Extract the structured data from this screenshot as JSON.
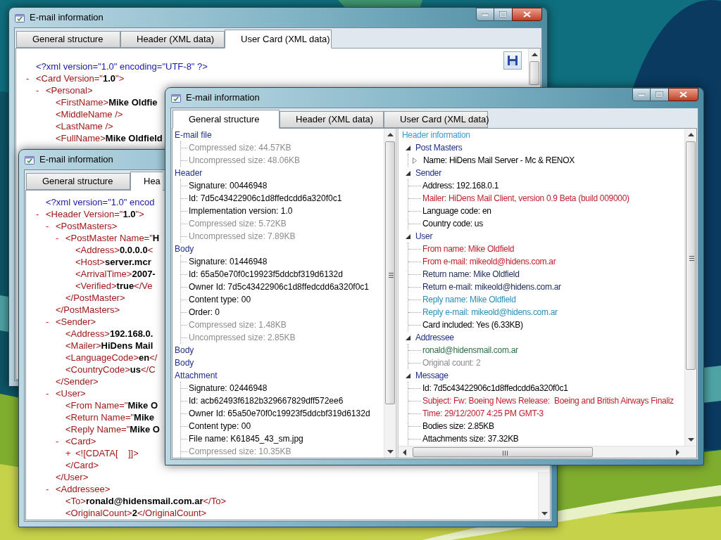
{
  "windows": [
    {
      "title": "E-mail information",
      "caption_buttons": true,
      "save_button": true,
      "tabs": [
        {
          "label": "General structure",
          "selected": false
        },
        {
          "label": "Header (XML data)",
          "selected": false
        },
        {
          "label": "User Card (XML data)",
          "selected": true
        }
      ],
      "xml": {
        "declaration": "<?xml version=\"1.0\" encoding=\"UTF-8\" ?>",
        "nodes": [
          {
            "text": "<Card Version=\"**1.0**\">",
            "toggle": "-",
            "children": [
              {
                "text": "<Personal>",
                "toggle": "-",
                "children": [
                  {
                    "text": "<FirstName>**Mike Oldfie**"
                  },
                  {
                    "text": "<MiddleName />"
                  },
                  {
                    "text": "<LastName />"
                  },
                  {
                    "text": "<FullName>**Mike Oldfield**"
                  }
                ]
              }
            ]
          }
        ]
      }
    },
    {
      "title": "E-mail information",
      "caption_buttons": false,
      "tabs": [
        {
          "label": "General structure",
          "selected": false
        },
        {
          "label": "Hea",
          "selected": true
        }
      ],
      "xml": {
        "declaration": "<?xml version=\"1.0\" encod",
        "nodes": [
          {
            "text": "<Header Version=\"**1.0**\">",
            "toggle": "-",
            "children": [
              {
                "text": "<PostMasters>",
                "toggle": "-",
                "close": "</PostMasters>",
                "children": [
                  {
                    "text": "<PostMaster Name=\"**H**",
                    "toggle": "-",
                    "close": "</PostMaster>",
                    "children": [
                      {
                        "text": "<Address>**0.0.0.0**<"
                      },
                      {
                        "text": "<Host>**server.mcr**"
                      },
                      {
                        "text": "<ArrivalTime>**2007-**"
                      },
                      {
                        "text": "<Verified>**true**</Ve"
                      }
                    ]
                  }
                ]
              },
              {
                "text": "<Sender>",
                "toggle": "-",
                "close": "</Sender>",
                "children": [
                  {
                    "text": "<Address>**192.168.0.**"
                  },
                  {
                    "text": "<Mailer>**HiDens Mail**"
                  },
                  {
                    "text": "<LanguageCode>**en**</"
                  },
                  {
                    "text": "<CountryCode>**us**</C"
                  }
                ]
              },
              {
                "text": "<User>",
                "toggle": "-",
                "close": "</User>",
                "children": [
                  {
                    "text": "<From Name=\"**Mike O**"
                  },
                  {
                    "text": "<Return Name=\"**Mike**"
                  },
                  {
                    "text": "<Reply Name=\"**Mike O**"
                  },
                  {
                    "text": "<Card>",
                    "toggle": "-",
                    "close": "</Card>",
                    "children": [
                      {
                        "text": "<![CDATA[    ]]>",
                        "toggle": "+"
                      }
                    ]
                  }
                ]
              },
              {
                "text": "<Addressee>",
                "toggle": "-",
                "children": [
                  {
                    "text": "<To>**ronald@hidensmail.com.ar**</To>"
                  },
                  {
                    "text": "<OriginalCount>**2**</OriginalCount>"
                  }
                ]
              }
            ]
          }
        ]
      }
    },
    {
      "title": "E-mail information",
      "caption_buttons": true,
      "tabs": [
        {
          "label": "General structure",
          "selected": true
        },
        {
          "label": "Header (XML data)",
          "selected": false
        },
        {
          "label": "User Card (XML data)",
          "selected": false
        }
      ],
      "left_tree": {
        "groups": [
          {
            "label": "E-mail file",
            "items": [
              {
                "text": "Compressed size: 44.57KB",
                "color": "#8c8c8c"
              },
              {
                "text": "Uncompressed size: 48.06KB",
                "color": "#8c8c8c"
              }
            ]
          },
          {
            "label": "Header",
            "items": [
              {
                "text": "Signature: 00446948",
                "color": "#000000"
              },
              {
                "text": "Id: 7d5c43422906c1d8ffedcdd6a320f0c1",
                "color": "#000000"
              },
              {
                "text": "Implementation version: 1.0",
                "color": "#000000"
              },
              {
                "text": "Compressed size: 5.72KB",
                "color": "#8c8c8c"
              },
              {
                "text": "Uncompressed size: 7.89KB",
                "color": "#8c8c8c"
              }
            ]
          },
          {
            "label": "Body",
            "items": [
              {
                "text": "Signature: 01446948",
                "color": "#000000"
              },
              {
                "text": "Id: 65a50e70f0c19923f5ddcbf319d6132d",
                "color": "#000000"
              },
              {
                "text": "Owner Id: 7d5c43422906c1d8ffedcdd6a320f0c1",
                "color": "#000000"
              },
              {
                "text": "Content type: 00",
                "color": "#000000"
              },
              {
                "text": "Order: 0",
                "color": "#000000"
              },
              {
                "text": "Compressed size: 1.48KB",
                "color": "#8c8c8c"
              },
              {
                "text": "Uncompressed size: 2.85KB",
                "color": "#8c8c8c"
              }
            ]
          },
          {
            "label": "Body"
          },
          {
            "label": "Body"
          },
          {
            "label": "Attachment",
            "items": [
              {
                "text": "Signature: 02446948",
                "color": "#000000"
              },
              {
                "text": "Id: acb62493f6182b329667829dff572ee6",
                "color": "#000000"
              },
              {
                "text": "Owner Id: 65a50e70f0c19923f5ddcbf319d6132d",
                "color": "#000000"
              },
              {
                "text": "Content type: 00",
                "color": "#000000"
              },
              {
                "text": "File name: K61845_43_sm.jpg",
                "color": "#000000"
              },
              {
                "text": "Compressed size: 10.35KB",
                "color": "#8c8c8c"
              }
            ]
          }
        ]
      },
      "right_tree": {
        "title": "Header information",
        "groups": [
          {
            "label": "Post Masters",
            "expanded": true,
            "items": [
              {
                "text": "Name: HiDens Mail Server - Mc & RENOX",
                "color": "#000000",
                "expanded": false
              }
            ]
          },
          {
            "label": "Sender",
            "expanded": true,
            "items": [
              {
                "text": "Address: 192.168.0.1",
                "color": "#000000"
              },
              {
                "text": "Mailer: HiDens Mail Client, version 0.9 Beta (build 009000)",
                "color": "#c0202c"
              },
              {
                "text": "Language code: en",
                "color": "#000000"
              },
              {
                "text": "Country code: us",
                "color": "#000000"
              }
            ]
          },
          {
            "label": "User",
            "expanded": true,
            "items": [
              {
                "text": "From name: Mike Oldfield",
                "color": "#c0202c"
              },
              {
                "text": "From e-mail: mikeold@hidens.com.ar",
                "color": "#c0202c"
              },
              {
                "text": "Return name: Mike Oldfield",
                "color": "#1c2a5c"
              },
              {
                "text": "Return e-mail: mikeold@hidens.com.ar",
                "color": "#1c2a5c"
              },
              {
                "text": "Reply name: Mike Oldfield",
                "color": "#2b8fb8"
              },
              {
                "text": "Reply e-mail: mikeold@hidens.com.ar",
                "color": "#2b8fb8"
              },
              {
                "text": "Card included: Yes (6.33KB)",
                "color": "#000000"
              }
            ]
          },
          {
            "label": "Addressee",
            "expanded": true,
            "items": [
              {
                "text": "ronald@hidensmail.com.ar",
                "color": "#2f7048"
              },
              {
                "text": "Original count: 2",
                "color": "#8c8c8c"
              }
            ]
          },
          {
            "label": "Message",
            "expanded": true,
            "items": [
              {
                "text": "Id: 7d5c43422906c1d8ffedcdd6a320f0c1",
                "color": "#000000"
              },
              {
                "text": "Subject: Fw: Boeing News Release:  Boeing and British Airways Finaliz",
                "color": "#c0202c"
              },
              {
                "text": "Time: 29/12/2007 4:25 PM GMT-3",
                "color": "#c0202c"
              },
              {
                "text": "Bodies size: 2.85KB",
                "color": "#000000"
              },
              {
                "text": "Attachments size: 37.32KB",
                "color": "#000000"
              }
            ]
          }
        ]
      }
    }
  ]
}
